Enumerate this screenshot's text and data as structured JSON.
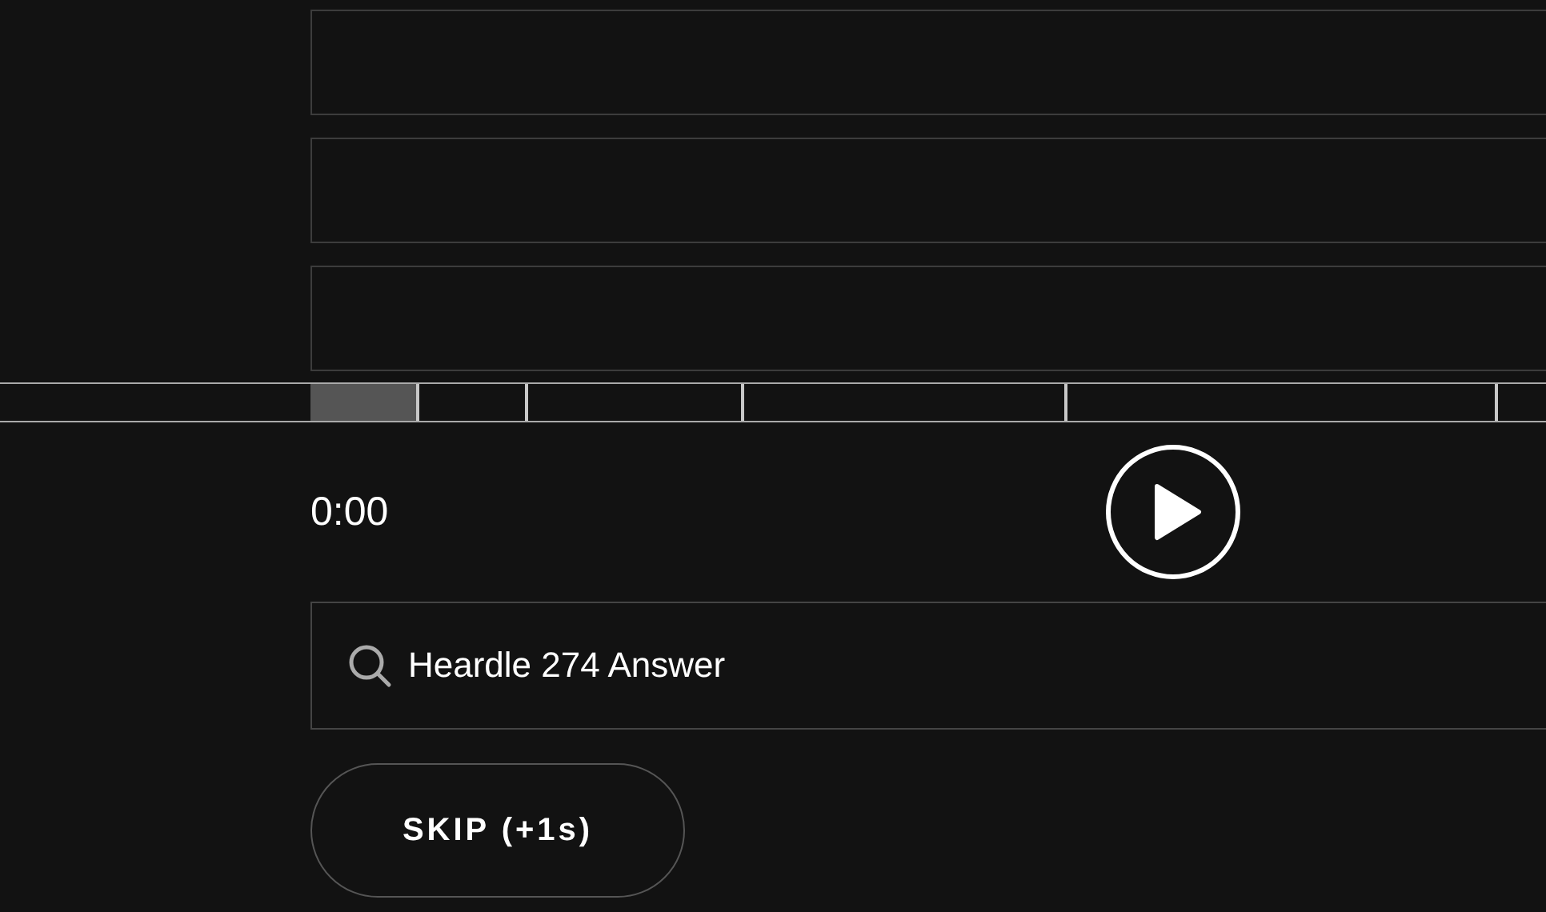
{
  "guess_slots": [
    {
      "filled": false
    },
    {
      "filled": false
    },
    {
      "filled": false
    }
  ],
  "player": {
    "time": "0:00",
    "playing": false
  },
  "search": {
    "value": "Heardle 274 Answer"
  },
  "skip_button": {
    "label": "SKIP (+1s)"
  }
}
